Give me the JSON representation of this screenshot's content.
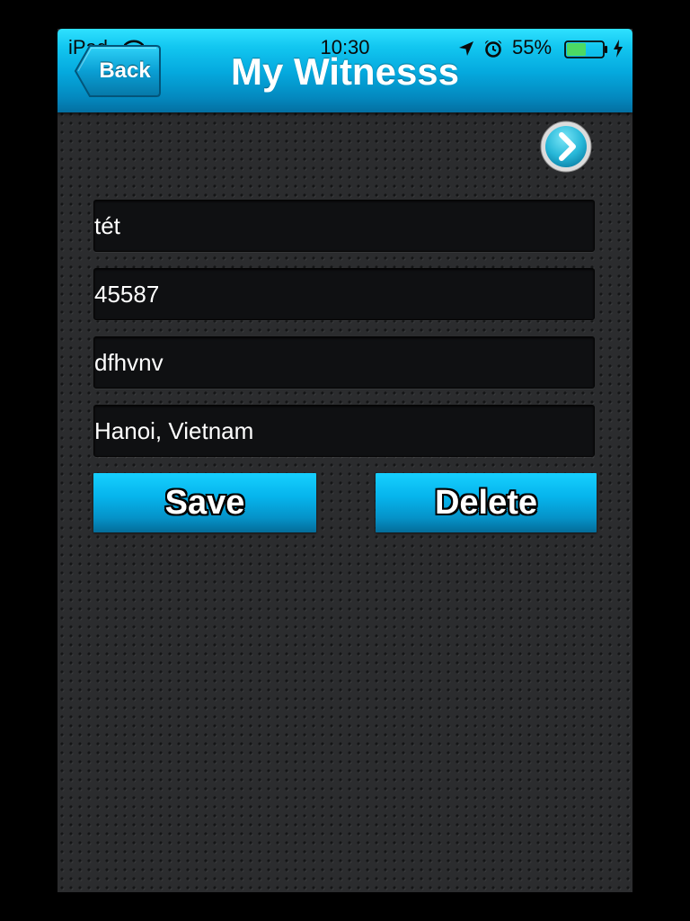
{
  "status_bar": {
    "carrier": "iPad",
    "time": "10:30",
    "battery_percent": "55%",
    "battery_level": 0.55,
    "icons": [
      "wifi-icon",
      "location-arrow-icon",
      "alarm-clock-icon",
      "battery-icon",
      "charging-bolt-icon"
    ]
  },
  "nav_bar": {
    "back_label": "Back",
    "title": "My Witnesss"
  },
  "next_button_icon": "chevron-right-icon",
  "form": {
    "name": "tét",
    "phone": "45587",
    "email": "dfhvnv",
    "address": "Hanoi, Vietnam"
  },
  "actions": {
    "save_label": "Save",
    "delete_label": "Delete"
  },
  "colors": {
    "accent": "#05a9de",
    "background": "#2b2c2e",
    "field_background": "#0f1012",
    "text": "#ffffff"
  }
}
